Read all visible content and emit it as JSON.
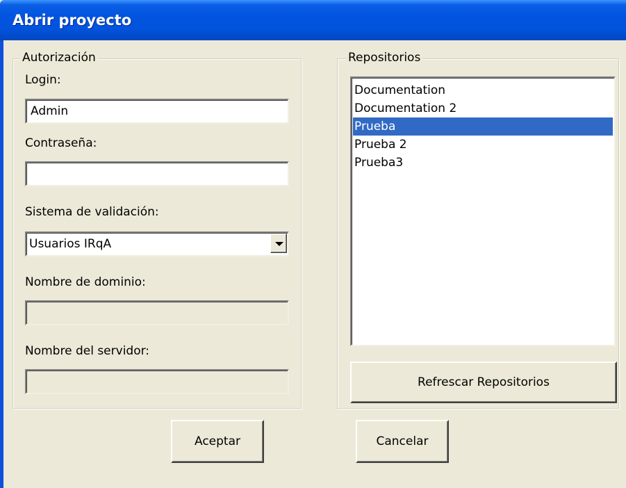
{
  "window": {
    "title": "Abrir proyecto"
  },
  "auth": {
    "legend": "Autorización",
    "login_label": "Login:",
    "login_value": "Admin",
    "password_label": "Contraseña:",
    "password_value": "",
    "validation_label": "Sistema de validación:",
    "validation_value": "Usuarios IRqA",
    "domain_label": "Nombre de dominio:",
    "domain_value": "",
    "server_label": "Nombre del servidor:",
    "server_value": ""
  },
  "repos": {
    "legend": "Repositorios",
    "items": [
      {
        "label": "Documentation",
        "selected": false
      },
      {
        "label": "Documentation 2",
        "selected": false
      },
      {
        "label": "Prueba",
        "selected": true
      },
      {
        "label": "Prueba 2",
        "selected": false
      },
      {
        "label": "Prueba3",
        "selected": false
      }
    ],
    "refresh_label": "Refrescar Repositorios"
  },
  "footer": {
    "accept_label": "Aceptar",
    "cancel_label": "Cancelar"
  },
  "colors": {
    "titlebar": "#0254E0",
    "dialog_bg": "#ECE9D8",
    "selection": "#316AC5"
  }
}
